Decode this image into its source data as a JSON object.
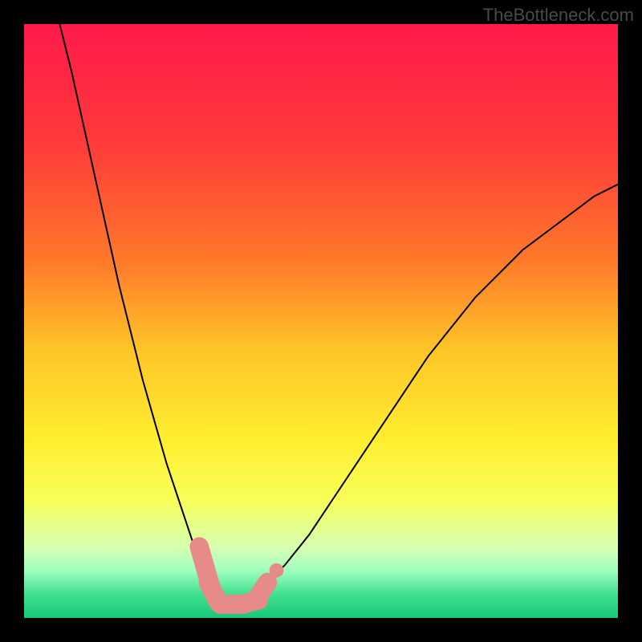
{
  "watermark": "TheBottleneck.com",
  "chart_data": {
    "type": "line",
    "title": "",
    "xlabel": "",
    "ylabel": "",
    "xlim": [
      0,
      100
    ],
    "ylim": [
      0,
      100
    ],
    "background_gradient": {
      "stops": [
        {
          "offset": 0,
          "color": "#ff1a4a"
        },
        {
          "offset": 20,
          "color": "#ff3a3a"
        },
        {
          "offset": 40,
          "color": "#ff7a2a"
        },
        {
          "offset": 55,
          "color": "#ffc528"
        },
        {
          "offset": 70,
          "color": "#ffee30"
        },
        {
          "offset": 80,
          "color": "#f7ff58"
        },
        {
          "offset": 88,
          "color": "#d8ffb0"
        },
        {
          "offset": 92,
          "color": "#a0ffc0"
        },
        {
          "offset": 96,
          "color": "#40e090"
        },
        {
          "offset": 100,
          "color": "#18c878"
        }
      ]
    },
    "series": [
      {
        "name": "left-curve",
        "x": [
          6,
          8,
          10,
          12,
          14,
          16,
          18,
          20,
          22,
          24,
          26,
          28,
          30,
          31,
          32
        ],
        "values": [
          100,
          92,
          83,
          74,
          65,
          56,
          48,
          40,
          33,
          26,
          20,
          14,
          8,
          5,
          3
        ]
      },
      {
        "name": "right-curve",
        "x": [
          38,
          40,
          44,
          48,
          52,
          56,
          60,
          64,
          68,
          72,
          76,
          80,
          84,
          88,
          92,
          96,
          100
        ],
        "values": [
          3,
          5,
          9,
          14,
          20,
          26,
          32,
          38,
          44,
          49,
          54,
          58,
          62,
          65,
          68,
          71,
          73
        ]
      },
      {
        "name": "bottom-link",
        "x": [
          31,
          33,
          35,
          37,
          39
        ],
        "values": [
          3,
          2.5,
          2.3,
          2.5,
          3
        ]
      }
    ],
    "markers": [
      {
        "name": "left-cap-top",
        "shape": "pill",
        "x1": 29.5,
        "y1": 12,
        "x2": 31.5,
        "y2": 5,
        "w": 3.2
      },
      {
        "name": "left-cap-bot",
        "shape": "pill",
        "x1": 31,
        "y1": 6,
        "x2": 32.5,
        "y2": 3,
        "w": 3.2
      },
      {
        "name": "left-dot",
        "shape": "dot",
        "x": 33,
        "y": 2.5,
        "r": 1.2
      },
      {
        "name": "bottom-pill-1",
        "shape": "pill",
        "x1": 33,
        "y1": 2.3,
        "x2": 37,
        "y2": 2.3,
        "w": 3.2
      },
      {
        "name": "bottom-pill-2",
        "shape": "pill",
        "x1": 36.5,
        "y1": 2.3,
        "x2": 39.5,
        "y2": 3,
        "w": 3.2
      },
      {
        "name": "right-cap",
        "shape": "pill",
        "x1": 39,
        "y1": 3,
        "x2": 41,
        "y2": 6,
        "w": 3.2
      },
      {
        "name": "right-dot",
        "shape": "dot",
        "x": 42.5,
        "y": 8,
        "r": 1.2
      }
    ],
    "marker_color": "#e78a8a",
    "curve_color": "#000000"
  }
}
